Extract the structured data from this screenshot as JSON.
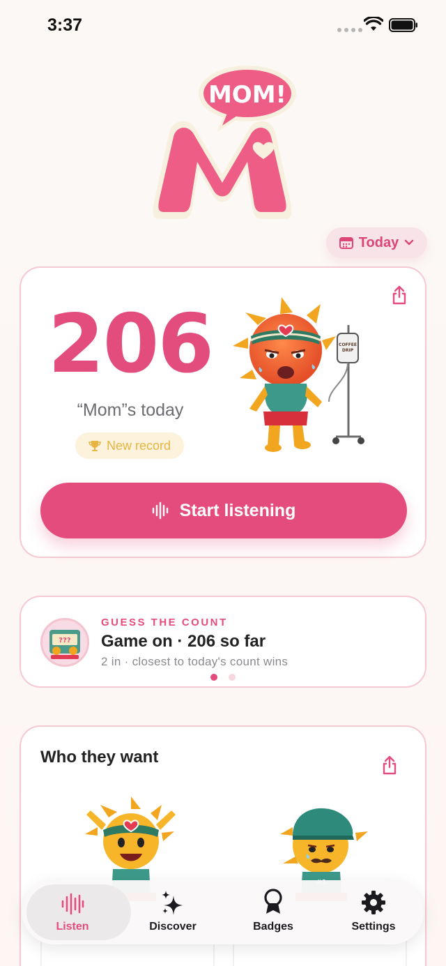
{
  "status_bar": {
    "time": "3:37"
  },
  "logo": {
    "bubble_text": "MOM!",
    "letter": "M"
  },
  "date_filter": {
    "label": "Today",
    "icon": "calendar-icon"
  },
  "counter_card": {
    "count": "206",
    "label": "“Mom”s today",
    "badge": "New record",
    "badge_icon": "trophy-icon",
    "button_label": "Start listening",
    "button_icon": "waveform-icon",
    "drip_text": "COFFEE DRIP"
  },
  "game_card": {
    "kicker": "GUESS THE COUNT",
    "title": "Game on · 206 so far",
    "subtitle": "2 in · closest to today's count wins",
    "page_index": 0,
    "page_count": 2
  },
  "who_card": {
    "title": "Who they want"
  },
  "tabs": [
    {
      "label": "Listen",
      "icon": "waveform-icon",
      "active": true
    },
    {
      "label": "Discover",
      "icon": "sparkles-icon",
      "active": false
    },
    {
      "label": "Badges",
      "icon": "ribbon-icon",
      "active": false
    },
    {
      "label": "Settings",
      "icon": "gear-icon",
      "active": false
    }
  ],
  "colors": {
    "accent": "#e34c7c",
    "card_border": "#f6c8d4",
    "record": "#e7b443"
  }
}
